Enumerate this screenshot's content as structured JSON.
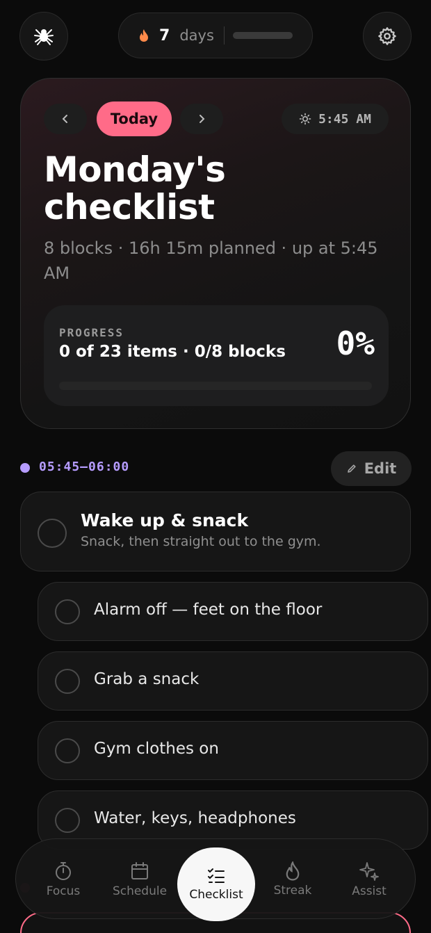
{
  "header": {
    "logo_icon": "spider-icon",
    "streak": {
      "icon": "flame-icon",
      "count": "7",
      "unit": "days",
      "progress": 0
    },
    "settings_icon": "gear-icon"
  },
  "hero": {
    "prev_icon": "chevron-left-icon",
    "today_label": "Today",
    "next_icon": "chevron-right-icon",
    "wake_icon": "sun-icon",
    "wake_time": "5:45 AM",
    "title": "Monday's checklist",
    "subtitle": "8 blocks · 16h 15m planned · up at 5:45 AM",
    "progress": {
      "label": "PROGRESS",
      "count_text": "0 of 23 items · 0/8 blocks",
      "percent_text": "0%",
      "value": 0
    }
  },
  "block": {
    "time": "05:45–06:00",
    "edit_label": "Edit",
    "edit_icon": "pencil-icon",
    "title": "Wake up & snack",
    "description": "Snack, then straight out to the gym.",
    "items": [
      "Alarm off — feet on the floor",
      "Grab a snack",
      "Gym clothes on",
      "Water, keys, headphones"
    ]
  },
  "colors": {
    "accent": "#ff6b88",
    "block_time": "#b69cff",
    "background": "#0b0b0b"
  },
  "nav": {
    "items": [
      {
        "label": "Focus",
        "icon": "stopwatch-icon"
      },
      {
        "label": "Schedule",
        "icon": "calendar-icon"
      },
      {
        "label": "Checklist",
        "icon": "checklist-icon",
        "active": true
      },
      {
        "label": "Streak",
        "icon": "flame-icon"
      },
      {
        "label": "Assist",
        "icon": "sparkle-icon"
      }
    ]
  }
}
